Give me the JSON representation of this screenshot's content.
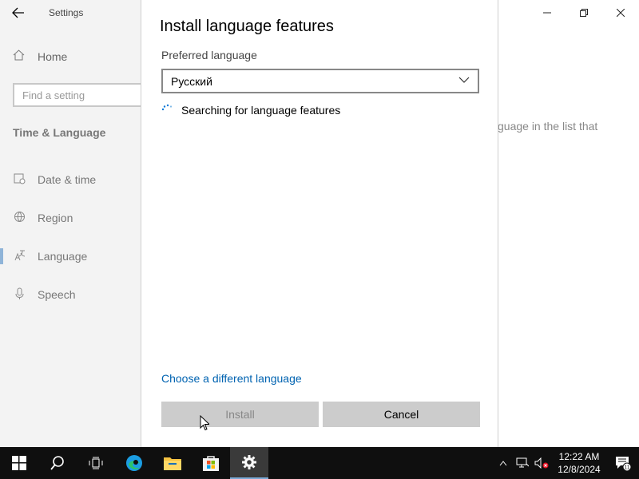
{
  "settings": {
    "app_title": "Settings",
    "home_label": "Home",
    "search_placeholder": "Find a setting",
    "section_title": "Time & Language",
    "nav": [
      {
        "label": "Date & time"
      },
      {
        "label": "Region"
      },
      {
        "label": "Language"
      },
      {
        "label": "Speech"
      }
    ],
    "background_text": "guage in the list that"
  },
  "dialog": {
    "title": "Install language features",
    "preferred_label": "Preferred language",
    "selected_language": "Русский",
    "status": "Searching for language features",
    "different_language_link": "Choose a different language",
    "install_label": "Install",
    "cancel_label": "Cancel"
  },
  "taskbar": {
    "time": "12:22 AM",
    "date": "12/8/2024",
    "notification_count": "11"
  },
  "colors": {
    "link": "#0063b1",
    "active_marker": "#8fb4d8",
    "taskbar": "#0f0f0f"
  }
}
